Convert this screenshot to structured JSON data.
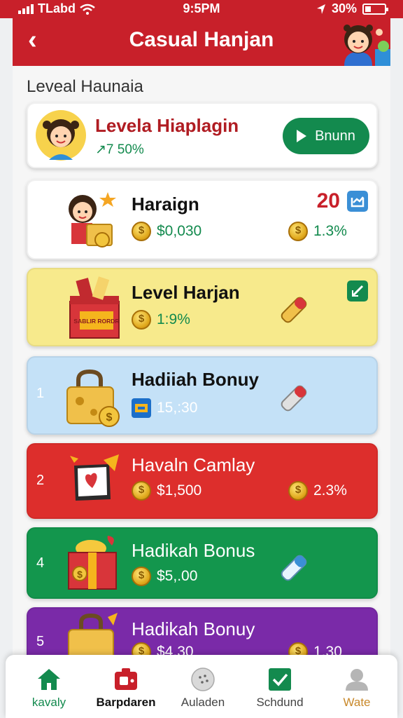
{
  "status_bar": {
    "carrier": "TLabd",
    "time": "9:5PM",
    "battery": "30%"
  },
  "header": {
    "title": "Casual Hanjan",
    "back_glyph": "‹"
  },
  "section": {
    "title": "Leveal Haunaia"
  },
  "feature": {
    "title": "Levela Hiaplagin",
    "stat": "↗7 50%",
    "button_label": "Bnunn"
  },
  "cards": [
    {
      "num": "",
      "title": "Haraign",
      "amount": "$0,030",
      "pct": "1.3%",
      "score": "20",
      "bg": "#ffffff"
    },
    {
      "num": "",
      "title": "Level Harjan",
      "amount": "1:9%",
      "pct": "",
      "bg": "#f7ea8c",
      "crate_text": "SABLIR RORDR"
    },
    {
      "num": "1",
      "title": "Hadiiah Bonuy",
      "amount": "15,:30",
      "pct": "",
      "bg": "#c4e1f7"
    },
    {
      "num": "2",
      "title": "Havaln Camlay",
      "amount": "$1,500",
      "pct": "2.3%",
      "bg": "#dd2e2c"
    },
    {
      "num": "4",
      "title": "Hadikah Bonus",
      "amount": "$5,.00",
      "pct": "",
      "bg": "#13964d"
    },
    {
      "num": "5",
      "title": "Hadikah Bonuy",
      "amount": "$4.30",
      "pct": "1.30",
      "bg": "#7a2aa8"
    }
  ],
  "tabs": [
    {
      "label": "kavaly",
      "icon": "home-icon",
      "color": "#138a4e"
    },
    {
      "label": "Barpdaren",
      "icon": "camera-icon",
      "color": "#c8202a"
    },
    {
      "label": "Auladen",
      "icon": "dots-icon",
      "color": "#888888"
    },
    {
      "label": "Schdund",
      "icon": "check-icon",
      "color": "#138a4e"
    },
    {
      "label": "Wate",
      "icon": "profile-icon",
      "color": "#999999"
    }
  ],
  "colors": {
    "brand_red": "#c8202a",
    "brand_green": "#138a4e"
  }
}
